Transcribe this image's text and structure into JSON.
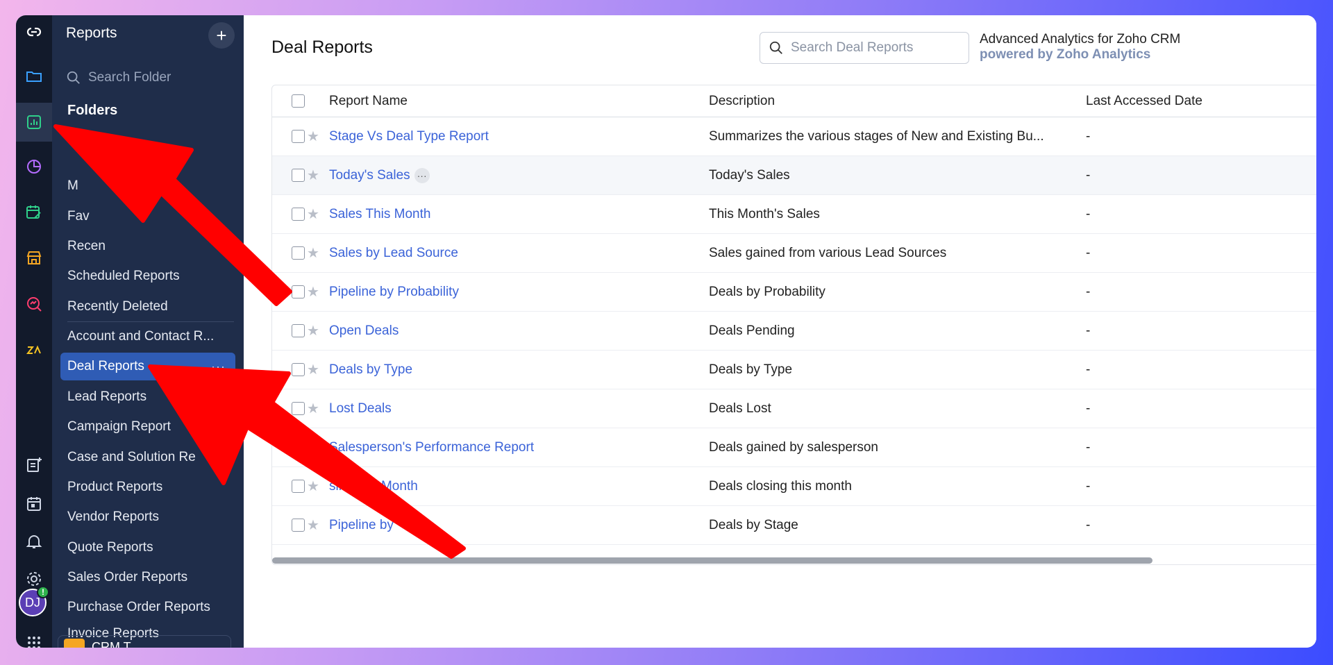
{
  "rail": {
    "items": [
      {
        "icon": "zoho-logo-icon",
        "color": "#ffffff"
      },
      {
        "icon": "folder-icon",
        "color": "#3aa0ff"
      },
      {
        "icon": "reports-icon",
        "color": "#2fcf8a"
      },
      {
        "icon": "analytics-icon",
        "color": "#b46cff"
      },
      {
        "icon": "calendar-edit-icon",
        "color": "#2fcf8a"
      },
      {
        "icon": "store-icon",
        "color": "#f5a623"
      },
      {
        "icon": "search-magnify-icon",
        "color": "#ff3d6e"
      },
      {
        "icon": "zia-icon",
        "color": "#f5c323"
      }
    ],
    "bottom": [
      "note-add-icon",
      "calendar-icon",
      "bell-icon",
      "gear-icon"
    ],
    "avatar_initials": "DJ",
    "avatar_badge": "!"
  },
  "sidebar": {
    "title": "Reports",
    "add_label": "+",
    "search_placeholder": "Search Folder",
    "folders_heading": "Folders",
    "items": [
      {
        "label": "M",
        "partial": true
      },
      {
        "label": "Fav",
        "partial": true
      },
      {
        "label": "Recen",
        "partial": true
      },
      {
        "label": "Scheduled Reports"
      },
      {
        "label": "Recently Deleted"
      },
      {
        "label": "Account and Contact R..."
      },
      {
        "label": "Deal Reports",
        "active": true,
        "more": "···"
      },
      {
        "label": "Lead Reports"
      },
      {
        "label": "Campaign Report"
      },
      {
        "label": "Case and Solution Re"
      },
      {
        "label": "Product Reports"
      },
      {
        "label": "Vendor Reports"
      },
      {
        "label": "Quote Reports"
      },
      {
        "label": "Sales Order Reports"
      },
      {
        "label": "Purchase Order Reports"
      },
      {
        "label": "Invoice Reports"
      }
    ],
    "footer_label": "CRM T"
  },
  "main": {
    "title": "Deal Reports",
    "search_placeholder": "Search Deal Reports",
    "analytics_line1": "Advanced Analytics for Zoho CRM",
    "analytics_line2": "powered by Zoho Analytics"
  },
  "table": {
    "columns": [
      "Report Name",
      "Description",
      "Last Accessed Date"
    ],
    "rows": [
      {
        "name": "Stage Vs Deal Type Report",
        "description": "Summarizes the various stages of New and Existing Bu...",
        "last_accessed": "-"
      },
      {
        "name": "Today's Sales",
        "description": "Today's Sales",
        "last_accessed": "-",
        "hover": true
      },
      {
        "name": "Sales This Month",
        "description": "This Month's Sales",
        "last_accessed": "-"
      },
      {
        "name": "Sales by Lead Source",
        "description": "Sales gained from various Lead Sources",
        "last_accessed": "-"
      },
      {
        "name": "Pipeline by Probability",
        "description": "Deals by Probability",
        "last_accessed": "-"
      },
      {
        "name": "Open Deals",
        "description": "Deals Pending",
        "last_accessed": "-"
      },
      {
        "name": "Deals by Type",
        "description": "Deals by Type",
        "last_accessed": "-"
      },
      {
        "name": "Lost Deals",
        "description": "Deals Lost",
        "last_accessed": "-"
      },
      {
        "name": "Salesperson's Performance Report",
        "description": "Deals gained by salesperson",
        "last_accessed": "-"
      },
      {
        "name": "sing this Month",
        "description": "Deals closing this month",
        "last_accessed": "-"
      },
      {
        "name": "Pipeline by",
        "description": "Deals by Stage",
        "last_accessed": "-"
      }
    ]
  },
  "colors": {
    "arrow": "#ff0000",
    "link": "#3b63d8",
    "sidebar_bg": "#1f2d4a",
    "active_item": "#2f5cb5"
  }
}
